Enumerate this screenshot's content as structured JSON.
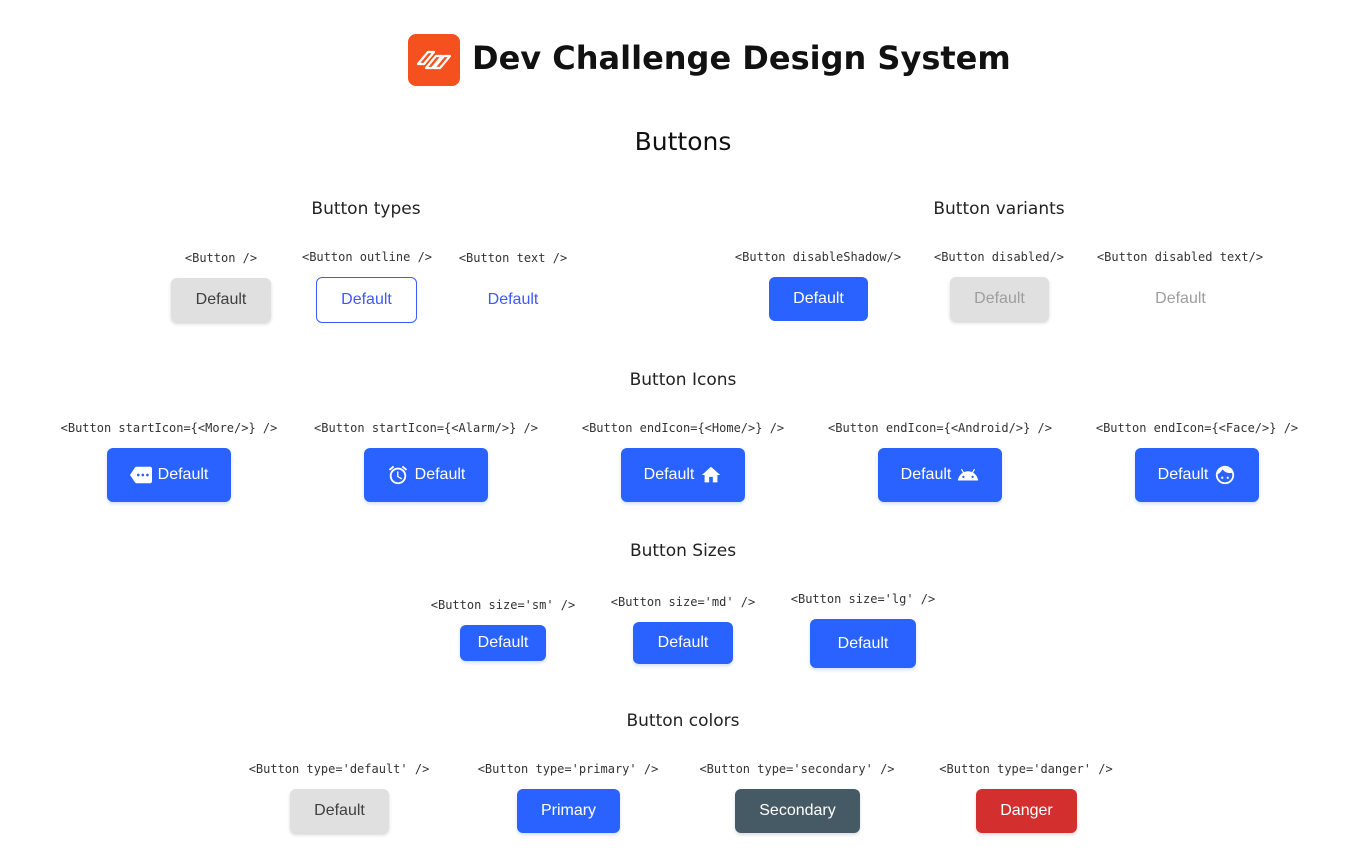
{
  "header": {
    "title": "Dev Challenge Design System",
    "logo_color": "#f4511e"
  },
  "page_title": "Buttons",
  "types": {
    "title": "Button types",
    "items": [
      {
        "code": "<Button />",
        "label": "Default"
      },
      {
        "code": "<Button outline />",
        "label": "Default"
      },
      {
        "code": "<Button text />",
        "label": "Default"
      }
    ]
  },
  "variants": {
    "title": "Button variants",
    "items": [
      {
        "code": "<Button disableShadow/>",
        "label": "Default"
      },
      {
        "code": "<Button disabled/>",
        "label": "Default"
      },
      {
        "code": "<Button disabled text/>",
        "label": "Default"
      }
    ]
  },
  "icons": {
    "title": "Button Icons",
    "items": [
      {
        "code": "<Button startIcon={<More/>} />",
        "label": "Default",
        "icon": "more-icon"
      },
      {
        "code": "<Button startIcon={<Alarm/>} />",
        "label": "Default",
        "icon": "alarm-icon"
      },
      {
        "code": "<Button endIcon={<Home/>} />",
        "label": "Default",
        "icon": "home-icon"
      },
      {
        "code": "<Button endIcon={<Android/>} />",
        "label": "Default",
        "icon": "android-icon"
      },
      {
        "code": "<Button endIcon={<Face/>} />",
        "label": "Default",
        "icon": "face-icon"
      }
    ]
  },
  "sizes": {
    "title": "Button Sizes",
    "items": [
      {
        "code": "<Button size='sm' />",
        "label": "Default"
      },
      {
        "code": "<Button size='md' />",
        "label": "Default"
      },
      {
        "code": "<Button size='lg' />",
        "label": "Default"
      }
    ]
  },
  "colors": {
    "title": "Button colors",
    "items": [
      {
        "code": "<Button type='default' />",
        "label": "Default"
      },
      {
        "code": "<Button type='primary' />",
        "label": "Primary"
      },
      {
        "code": "<Button type='secondary' />",
        "label": "Secondary"
      },
      {
        "code": "<Button type='danger' />",
        "label": "Danger"
      }
    ]
  },
  "palette": {
    "default": "#e0e0e0",
    "primary": "#2962ff",
    "secondary": "#455a64",
    "danger": "#d32f2f"
  }
}
